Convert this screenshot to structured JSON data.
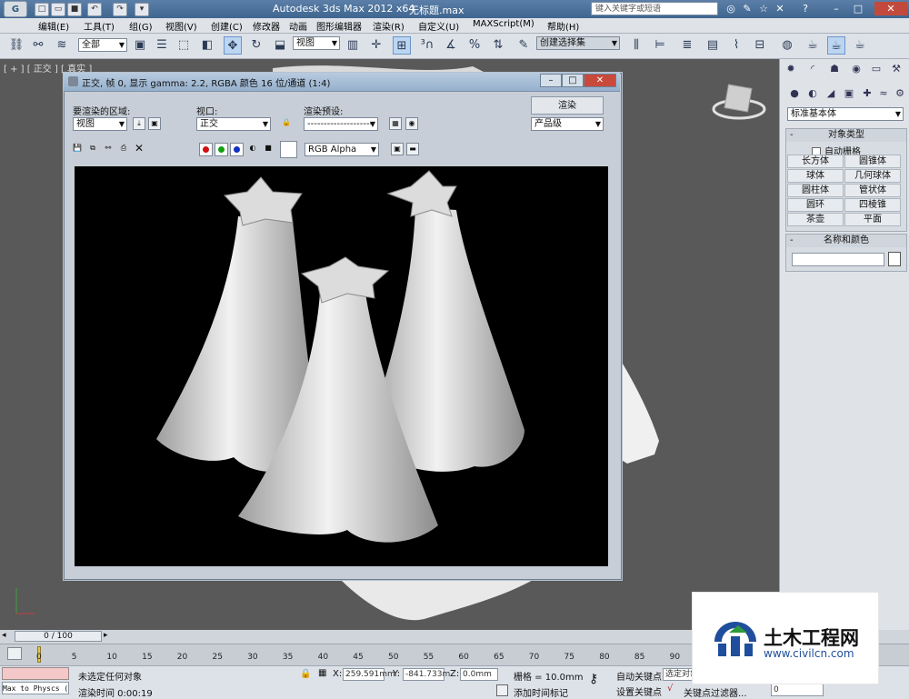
{
  "app": {
    "title": "Autodesk 3ds Max  2012 x64",
    "file": "无标题.max",
    "search_placeholder": "键入关键字或短语"
  },
  "menu": [
    "编辑(E)",
    "工具(T)",
    "组(G)",
    "视图(V)",
    "创建(C)",
    "修改器",
    "动画",
    "图形编辑器",
    "渲染(R)",
    "自定义(U)",
    "MAXScript(M)",
    "帮助(H)"
  ],
  "toolbar": {
    "selection_filter": "全部",
    "ref_coord": "视图",
    "named_selection": "创建选择集"
  },
  "viewport": {
    "label": "[ + ] [ 正交 ] [ 真实 ]"
  },
  "command_panel": {
    "category": "标准基本体",
    "object_type_title": "对象类型",
    "autogrid_label": "自动栅格",
    "buttons": [
      "长方体",
      "圆锥体",
      "球体",
      "几何球体",
      "圆柱体",
      "管状体",
      "圆环",
      "四棱锥",
      "茶壶",
      "平面"
    ],
    "name_color_title": "名称和颜色",
    "collapse_symbol": "-"
  },
  "frame_window": {
    "title": "正交, 帧 0, 显示 gamma: 2.2, RGBA 颜色 16 位/通道 (1:4)",
    "area_label": "要渲染的区域:",
    "area_value": "视图",
    "viewport_label": "视口:",
    "viewport_value": "正交",
    "preset_label": "渲染预设:",
    "preset_value": "--------------------",
    "render_button": "渲染",
    "quality_value": "产品级",
    "channel_value": "RGB Alpha"
  },
  "timeline": {
    "frame_display": "0 / 100",
    "ticks": [
      "0",
      "5",
      "10",
      "15",
      "20",
      "25",
      "30",
      "35",
      "40",
      "45",
      "50",
      "55",
      "60",
      "65",
      "70",
      "75",
      "80",
      "85",
      "90"
    ]
  },
  "status": {
    "script_listener": "Max to Physcs (",
    "selection": "未选定任何对象",
    "render_time": "渲染时间  0:00:19",
    "x_label": "X:",
    "x_value": "259.591mm",
    "y_label": "Y:",
    "y_value": "-841.733m",
    "z_label": "Z:",
    "z_value": "0.0mm",
    "grid": "栅格 = 10.0mm",
    "add_time_tag": "添加时间标记",
    "auto_key": "自动关键点",
    "set_key": "设置关键点",
    "selected": "选定对象",
    "key_filters": "关键点过滤器...",
    "frame_input": "0"
  },
  "watermark": {
    "name": "土木工程网",
    "url": "www.civilcn.com"
  },
  "colors": {
    "title_blue": "#4a6f9a",
    "ui_gray": "#dde2e8",
    "viewport": "#595959",
    "render_bg": "#000000",
    "watermark_blue": "#1f4e9c"
  }
}
